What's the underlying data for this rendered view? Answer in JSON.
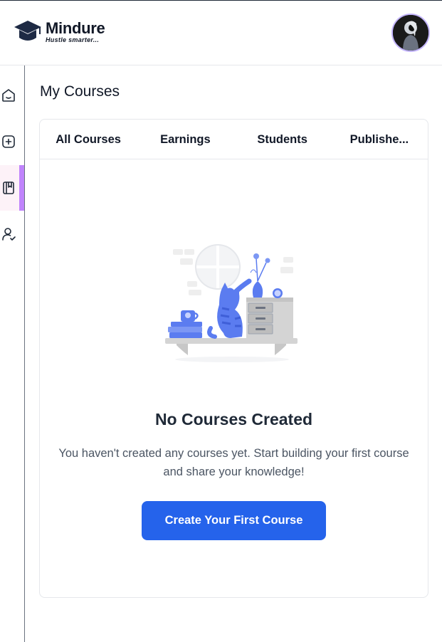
{
  "header": {
    "brand_name": "Mindure",
    "brand_tagline": "Hustle smarter...",
    "logo_icon": "graduation-cap-icon",
    "avatar_icon": "user-avatar"
  },
  "sidebar": {
    "items": [
      {
        "icon": "home-icon",
        "active": false
      },
      {
        "icon": "add-square-icon",
        "active": false
      },
      {
        "icon": "book-bookmark-icon",
        "active": true
      },
      {
        "icon": "user-check-icon",
        "active": false
      }
    ],
    "active_accent": "#c084fc"
  },
  "main": {
    "title": "My Courses",
    "tabs": [
      {
        "label": "All Courses"
      },
      {
        "label": "Earnings"
      },
      {
        "label": "Students"
      },
      {
        "label": "Publishe..."
      }
    ],
    "empty_state": {
      "illustration": "cat-on-shelf-illustration",
      "title": "No Courses Created",
      "description": "You haven't created any courses yet. Start building your first course and share your knowledge!",
      "cta_label": "Create Your First Course"
    }
  },
  "colors": {
    "primary": "#2563eb",
    "illustration_accent": "#5b7cf0"
  }
}
